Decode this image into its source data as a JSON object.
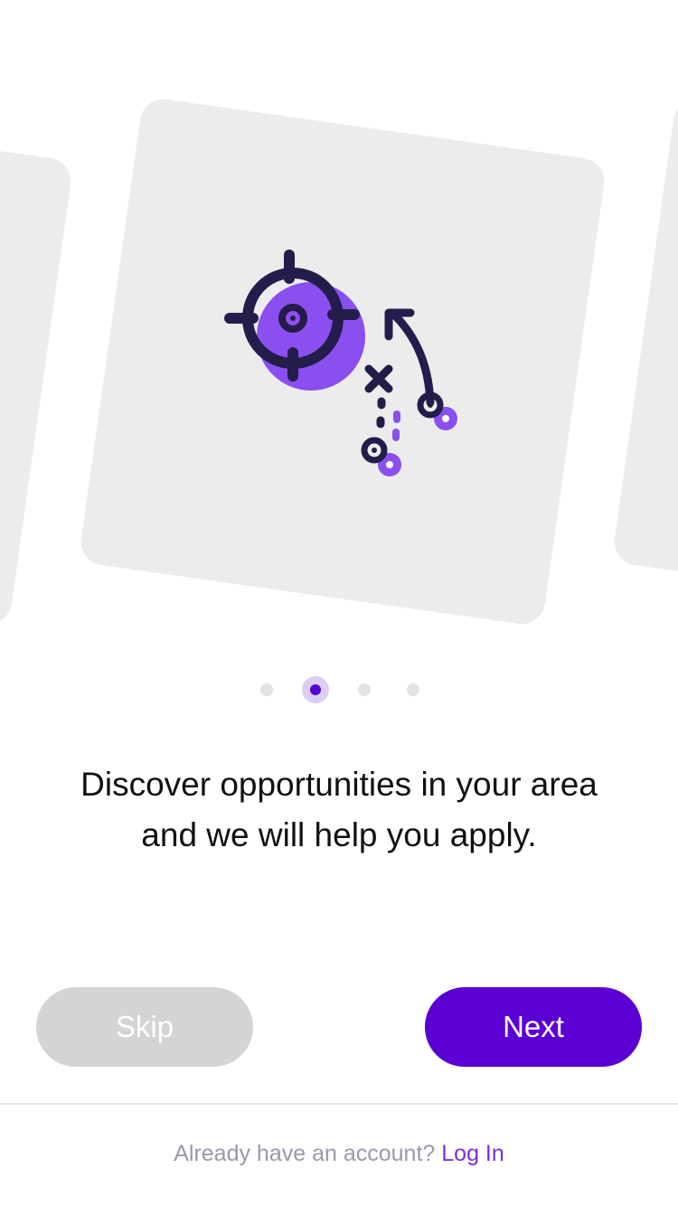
{
  "onboarding": {
    "headline_line1": "Discover opportunities in your area",
    "headline_line2": "and we will help you apply.",
    "illustration_icon": "target-strategy-icon",
    "pager": {
      "count": 4,
      "active_index": 1
    }
  },
  "actions": {
    "skip_label": "Skip",
    "next_label": "Next"
  },
  "footer": {
    "prompt": "Already have an account?",
    "login_label": "Log In"
  },
  "colors": {
    "accent": "#5a00d2",
    "accent_light": "#8b4ff0",
    "ink": "#221d4a",
    "card": "#ececec",
    "skip_bg": "#d4d4d4",
    "link": "#7a2fe0"
  }
}
